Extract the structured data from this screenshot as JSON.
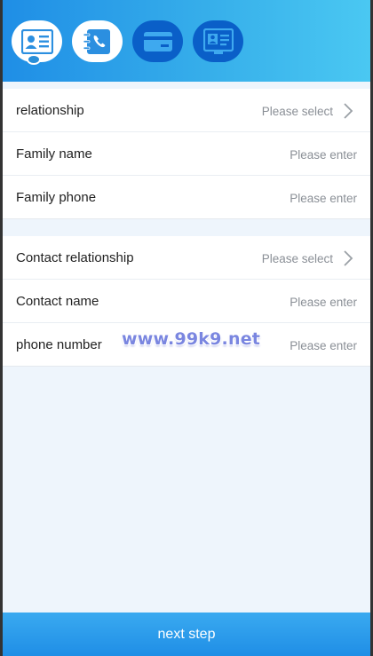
{
  "colors": {
    "header_gradient_start": "#1f8ee6",
    "header_gradient_end": "#4ac8f2",
    "step_active_bg": "#ffffff",
    "step_inactive_bg": "#0a5fc8",
    "label_text": "#222222",
    "placeholder_text": "#8a8f96",
    "button_bg": "#1f8ee6",
    "watermark": "#7a86e0"
  },
  "steps": [
    {
      "icon": "id-card-icon",
      "state": "active"
    },
    {
      "icon": "phone-book-icon",
      "state": "done"
    },
    {
      "icon": "bank-card-icon",
      "state": "pending"
    },
    {
      "icon": "license-icon",
      "state": "pending"
    }
  ],
  "family_section": {
    "rows": [
      {
        "label": "relationship",
        "value": "Please select",
        "type": "select"
      },
      {
        "label": "Family name",
        "value": "Please enter",
        "type": "input"
      },
      {
        "label": "Family phone",
        "value": "Please enter",
        "type": "input"
      }
    ]
  },
  "contact_section": {
    "rows": [
      {
        "label": "Contact relationship",
        "value": "Please select",
        "type": "select"
      },
      {
        "label": "Contact name",
        "value": "Please enter",
        "type": "input"
      },
      {
        "label": "phone number",
        "value": "Please enter",
        "type": "input"
      }
    ]
  },
  "watermark": "www.99k9.net",
  "footer": {
    "next_label": "next step"
  }
}
